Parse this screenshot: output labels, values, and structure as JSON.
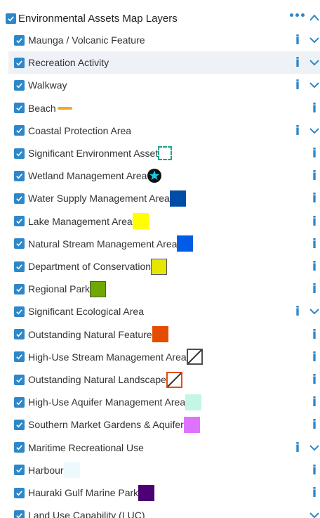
{
  "panel": {
    "title": "Environmental Assets Map Layers",
    "icons": {
      "checkbox": "checkmark-icon",
      "more": "more-dots-icon",
      "collapse": "chevron-up-icon",
      "expand": "chevron-down-icon",
      "info": "info-icon"
    },
    "accent_color": "#2d87c9"
  },
  "layers": [
    {
      "label": "Maunga / Volcanic Feature",
      "expandable": true
    },
    {
      "label": "Recreation Activity",
      "expandable": true,
      "highlighted": true
    },
    {
      "label": "Walkway",
      "expandable": true
    },
    {
      "label": "Beach",
      "expandable": false,
      "symbol": {
        "shape": "line",
        "color": "#f5a623"
      }
    },
    {
      "label": "Coastal Protection Area",
      "expandable": true
    },
    {
      "label": "Significant Environment Asset",
      "expandable": false,
      "symbol": {
        "shape": "dashed-square",
        "color": "#1aa68c"
      }
    },
    {
      "label": "Wetland Management Area",
      "expandable": false,
      "symbol": {
        "shape": "star-circle",
        "color": "#1ec8e6"
      }
    },
    {
      "label": "Water Supply Management Area",
      "expandable": false,
      "symbol": {
        "shape": "square",
        "color": "#004da8"
      }
    },
    {
      "label": "Lake Management Area",
      "expandable": false,
      "symbol": {
        "shape": "square",
        "color": "#ffff00"
      }
    },
    {
      "label": "Natural Stream Management Area",
      "expandable": false,
      "symbol": {
        "shape": "square",
        "color": "#005ce6"
      }
    },
    {
      "label": "Department of Conservation",
      "expandable": false,
      "symbol": {
        "shape": "square-outline",
        "color": "#e6e600"
      }
    },
    {
      "label": "Regional Park",
      "expandable": false,
      "symbol": {
        "shape": "square-outline",
        "color": "#70a800"
      }
    },
    {
      "label": "Significant Ecological Area",
      "expandable": true
    },
    {
      "label": "Outstanding Natural Feature",
      "expandable": false,
      "symbol": {
        "shape": "square",
        "color": "#e64c00"
      }
    },
    {
      "label": "High-Use Stream Management Area",
      "expandable": false,
      "symbol": {
        "shape": "slash-box",
        "color": "#4e4e4e"
      }
    },
    {
      "label": "Outstanding Natural Landscape",
      "expandable": false,
      "symbol": {
        "shape": "slash-box",
        "color": "#e64c00"
      }
    },
    {
      "label": "High-Use Aquifer Management Area",
      "expandable": false,
      "symbol": {
        "shape": "square",
        "color": "#c5f5e6"
      }
    },
    {
      "label": "Southern Market Gardens & Aquifer",
      "expandable": false,
      "symbol": {
        "shape": "square",
        "color": "#df73ff"
      }
    },
    {
      "label": "Maritime Recreational Use",
      "expandable": true
    },
    {
      "label": "Harbour",
      "expandable": false,
      "symbol": {
        "shape": "square",
        "color": "#eef9fd"
      }
    },
    {
      "label": "Hauraki Gulf Marine Park",
      "expandable": false,
      "symbol": {
        "shape": "square",
        "color": "#4c0073"
      }
    },
    {
      "label": "Land Use Capability (LUC)",
      "expandable": true,
      "no_info": true
    }
  ]
}
